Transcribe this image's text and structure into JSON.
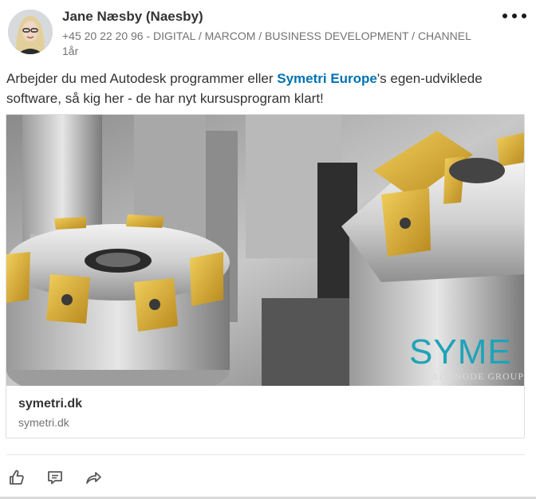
{
  "post": {
    "author": {
      "name": "Jane Næsby (Naesby)",
      "headline": "+45 20 22 20 96 - DIGITAL / MARCOM / BUSINESS DEVELOPMENT / CHANNEL",
      "timestamp": "1år"
    },
    "text_before_link": "Arbejder du med Autodesk programmer eller ",
    "text_link": "Symetri Europe",
    "text_after_link": "'s egen-udviklede software, så kig her - de har nyt kursusprogram klart!",
    "link_card": {
      "title": "symetri.dk",
      "domain": "symetri.dk",
      "image_logo_main": "SYME",
      "image_logo_sub": "ADDNODE GROUP"
    },
    "actions": {
      "like_icon": "thumbs-up-icon",
      "comment_icon": "comment-icon",
      "share_icon": "share-icon"
    },
    "more_icon": "ellipsis-icon"
  },
  "colors": {
    "link": "#0073b1",
    "secondary_text": "#737373",
    "primary_text": "#333333",
    "logo_cyan": "#1fa3b8"
  }
}
